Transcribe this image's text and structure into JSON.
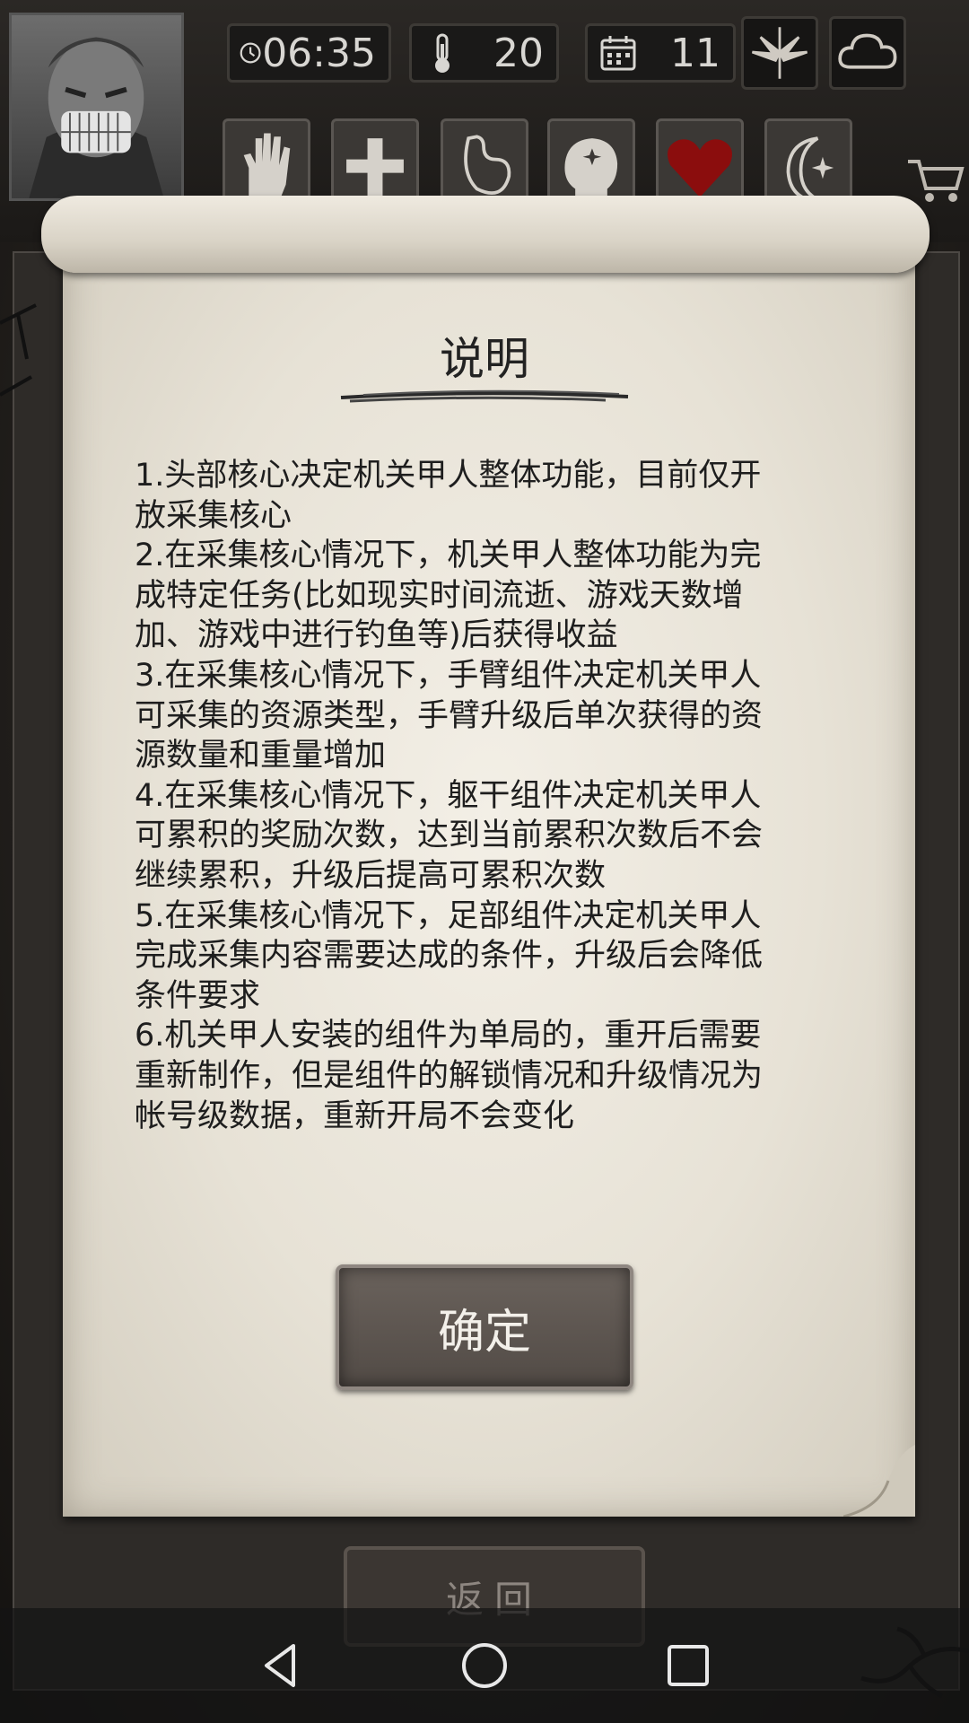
{
  "hud": {
    "time": "06:35",
    "temperature": "20",
    "day": "11"
  },
  "dialog": {
    "title": "说明",
    "lines": [
      "1.头部核心决定机关甲人整体功能，目前仅开",
      "放采集核心",
      "2.在采集核心情况下，机关甲人整体功能为完",
      "成特定任务(比如现实时间流逝、游戏天数增",
      "加、游戏中进行钓鱼等)后获得收益",
      "3.在采集核心情况下，手臂组件决定机关甲人",
      "可采集的资源类型，手臂升级后单次获得的资",
      "源数量和重量增加",
      "4.在采集核心情况下，躯干组件决定机关甲人",
      "可累积的奖励次数，达到当前累积次数后不会",
      "继续累积，升级后提高可累积次数",
      "5.在采集核心情况下，足部组件决定机关甲人",
      "完成采集内容需要达成的条件，升级后会降低",
      "条件要求",
      "6.机关甲人安装的组件为单局的，重开后需要",
      "重新制作，但是组件的解锁情况和升级情况为",
      "帐号级数据，重新开局不会变化"
    ],
    "confirm_label": "确定"
  },
  "back_label": "返回",
  "icons": {
    "clock": "clock-icon",
    "thermometer": "thermometer-icon",
    "calendar": "calendar-icon",
    "leaf": "leaf-icon",
    "cloud": "cloud-icon",
    "cart": "cart-icon"
  },
  "colors": {
    "heart": "#8b0d0d",
    "parchment": "#e9e4d8",
    "button": "#5c5550"
  }
}
